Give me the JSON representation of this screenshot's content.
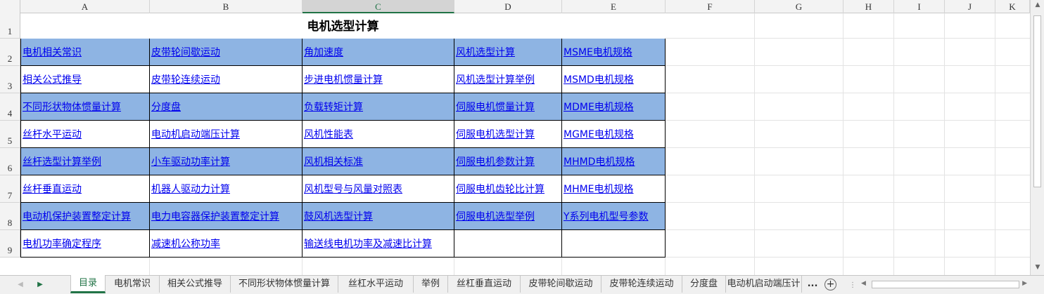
{
  "columns": [
    "A",
    "B",
    "C",
    "D",
    "E",
    "F",
    "G",
    "H",
    "I",
    "J",
    "K"
  ],
  "rows": [
    "1",
    "2",
    "3",
    "4",
    "5",
    "6",
    "7",
    "8",
    "9"
  ],
  "selected_column": "C",
  "title": "电机选型计算",
  "grid": [
    [
      "电机相关常识",
      "皮带轮间歇运动 ",
      "角加速度 ",
      "风机选型计算",
      "MSME电机规格"
    ],
    [
      "相关公式推导",
      "皮带轮连续运动 ",
      "步进电机惯量计算",
      "风机选型计算举例",
      "MSMD电机规格"
    ],
    [
      "不同形状物体惯量计算",
      "分度盘",
      "负载转矩计算",
      "伺服电机惯量计算",
      "MDME电机规格"
    ],
    [
      "丝杆水平运动",
      "电动机启动端压计算 ",
      "风机性能表",
      "伺服电机选型计算",
      "MGME电机规格"
    ],
    [
      "丝杆选型计算举例",
      "小车驱动功率计算",
      "风机相关标准",
      "伺服电机参数计算",
      "MHMD电机规格"
    ],
    [
      "丝杆垂直运动",
      "机器人驱动力计算",
      "风机型号与风量对照表",
      " 伺服电机齿轮比计算",
      "MHME电机规格"
    ],
    [
      "电动机保护装置整定计算",
      "电力电容器保护装置整定计算",
      "鼓风机选型计算 ",
      "伺服电机选型举例",
      "Y系列电机型号参数"
    ],
    [
      "电机功率确定程序",
      "减速机公称功率",
      "输送线电机功率及减速比计算",
      "",
      ""
    ]
  ],
  "highlight_color": "#8eb4e3",
  "tabs": [
    "目录",
    "电机常识",
    "相关公式推导",
    "不同形状物体惯量计算",
    "丝杠水平运动",
    "举例",
    "丝杠垂直运动",
    "皮带轮间歇运动",
    "皮带轮连续运动",
    "分度盘",
    "电动机启动端压计"
  ],
  "active_tab": 0,
  "more_tabs": "...",
  "add_sheet": "⊕"
}
